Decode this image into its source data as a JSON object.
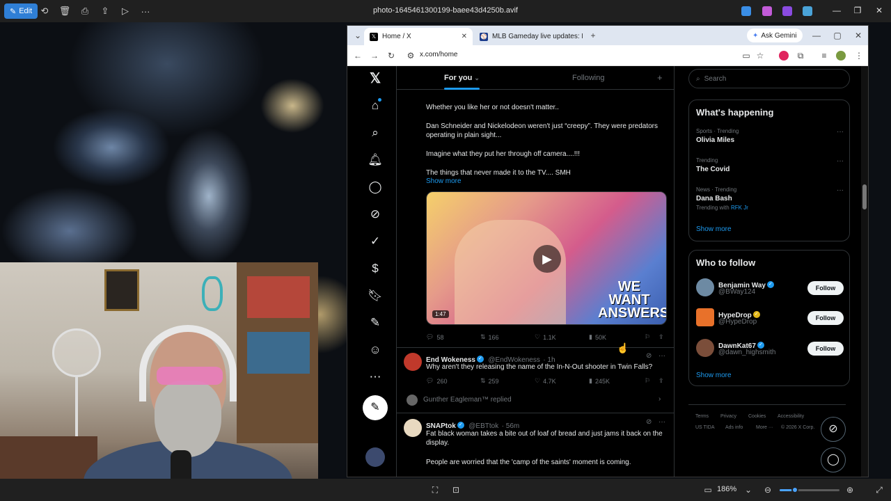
{
  "photos_app": {
    "edit_label": "Edit",
    "file_name": "photo-1645461300199-baee43d4250b.avif",
    "zoom": "186%",
    "zoom_level_fraction": 0.25
  },
  "browser": {
    "tabs": [
      {
        "title": "Home / X",
        "active": true
      },
      {
        "title": "MLB Gameday live updates: Pir",
        "active": false
      }
    ],
    "new_tab_label": "+",
    "ask_gemini": "Ask Gemini",
    "url": "x.com/home"
  },
  "x": {
    "feed_tabs": {
      "for_you": "For you",
      "following": "Following"
    },
    "post1": {
      "lines": [
        "Whether you like her or not doesn't matter..",
        "Dan Schneider and Nickelodeon weren't just “creepy”. They were predators operating in plain sight...",
        "Imagine what they put her through off camera....!!!",
        "The things that never made it to the TV.... SMH"
      ],
      "show_more": "Show more",
      "video_duration": "1:47",
      "video_overlay_text": "WE WANT ANSWERS",
      "replies": "58",
      "reposts": "166",
      "likes": "1.1K",
      "views": "50K"
    },
    "post2": {
      "name": "End Wokeness",
      "handle": "@EndWokeness",
      "time": "· 1h",
      "text": "Why aren't they releasing the name of the In-N-Out shooter in Twin Falls?",
      "replies": "260",
      "reposts": "259",
      "likes": "4.7K",
      "views": "245K",
      "replied_by": "Gunther Eagleman™ replied"
    },
    "post3": {
      "name": "SNAPtok",
      "handle": "@EBTtok",
      "time": "· 56m",
      "text": "Fat black woman takes a bite out of loaf of bread and just jams it back on the display.",
      "text2": "People are worried that the 'camp of the saints' moment is coming."
    },
    "search_placeholder": "Search",
    "whats_happening": {
      "title": "What's happening",
      "trends": [
        {
          "category": "Sports · Trending",
          "name": "Olivia Miles",
          "extra": ""
        },
        {
          "category": "Trending",
          "name": "The Covid",
          "extra": ""
        },
        {
          "category": "News · Trending",
          "name": "Dana Bash",
          "extra_prefix": "Trending with",
          "extra": "RFK Jr"
        }
      ],
      "show_more": "Show more"
    },
    "who_to_follow": {
      "title": "Who to follow",
      "users": [
        {
          "name": "Benjamin Way",
          "handle": "@BWay124",
          "button": "Follow",
          "badge": "blue"
        },
        {
          "name": "HypeDrop",
          "handle": "@HypeDrop",
          "button": "Follow",
          "badge": "gold"
        },
        {
          "name": "DawnKat67",
          "handle": "@dawn_highsmith",
          "button": "Follow",
          "badge": "blue"
        }
      ],
      "show_more": "Show more"
    },
    "footer": {
      "links": [
        "Terms",
        "Privacy",
        "Cookies",
        "Accessibility",
        "US TIDA",
        "Ads info",
        "More ···",
        "© 2026 X Corp."
      ]
    }
  },
  "colors": {
    "x_blue": "#1d9bf0",
    "photos_accent": "#4aa3ff",
    "edit_button": "#2f7fd6"
  }
}
